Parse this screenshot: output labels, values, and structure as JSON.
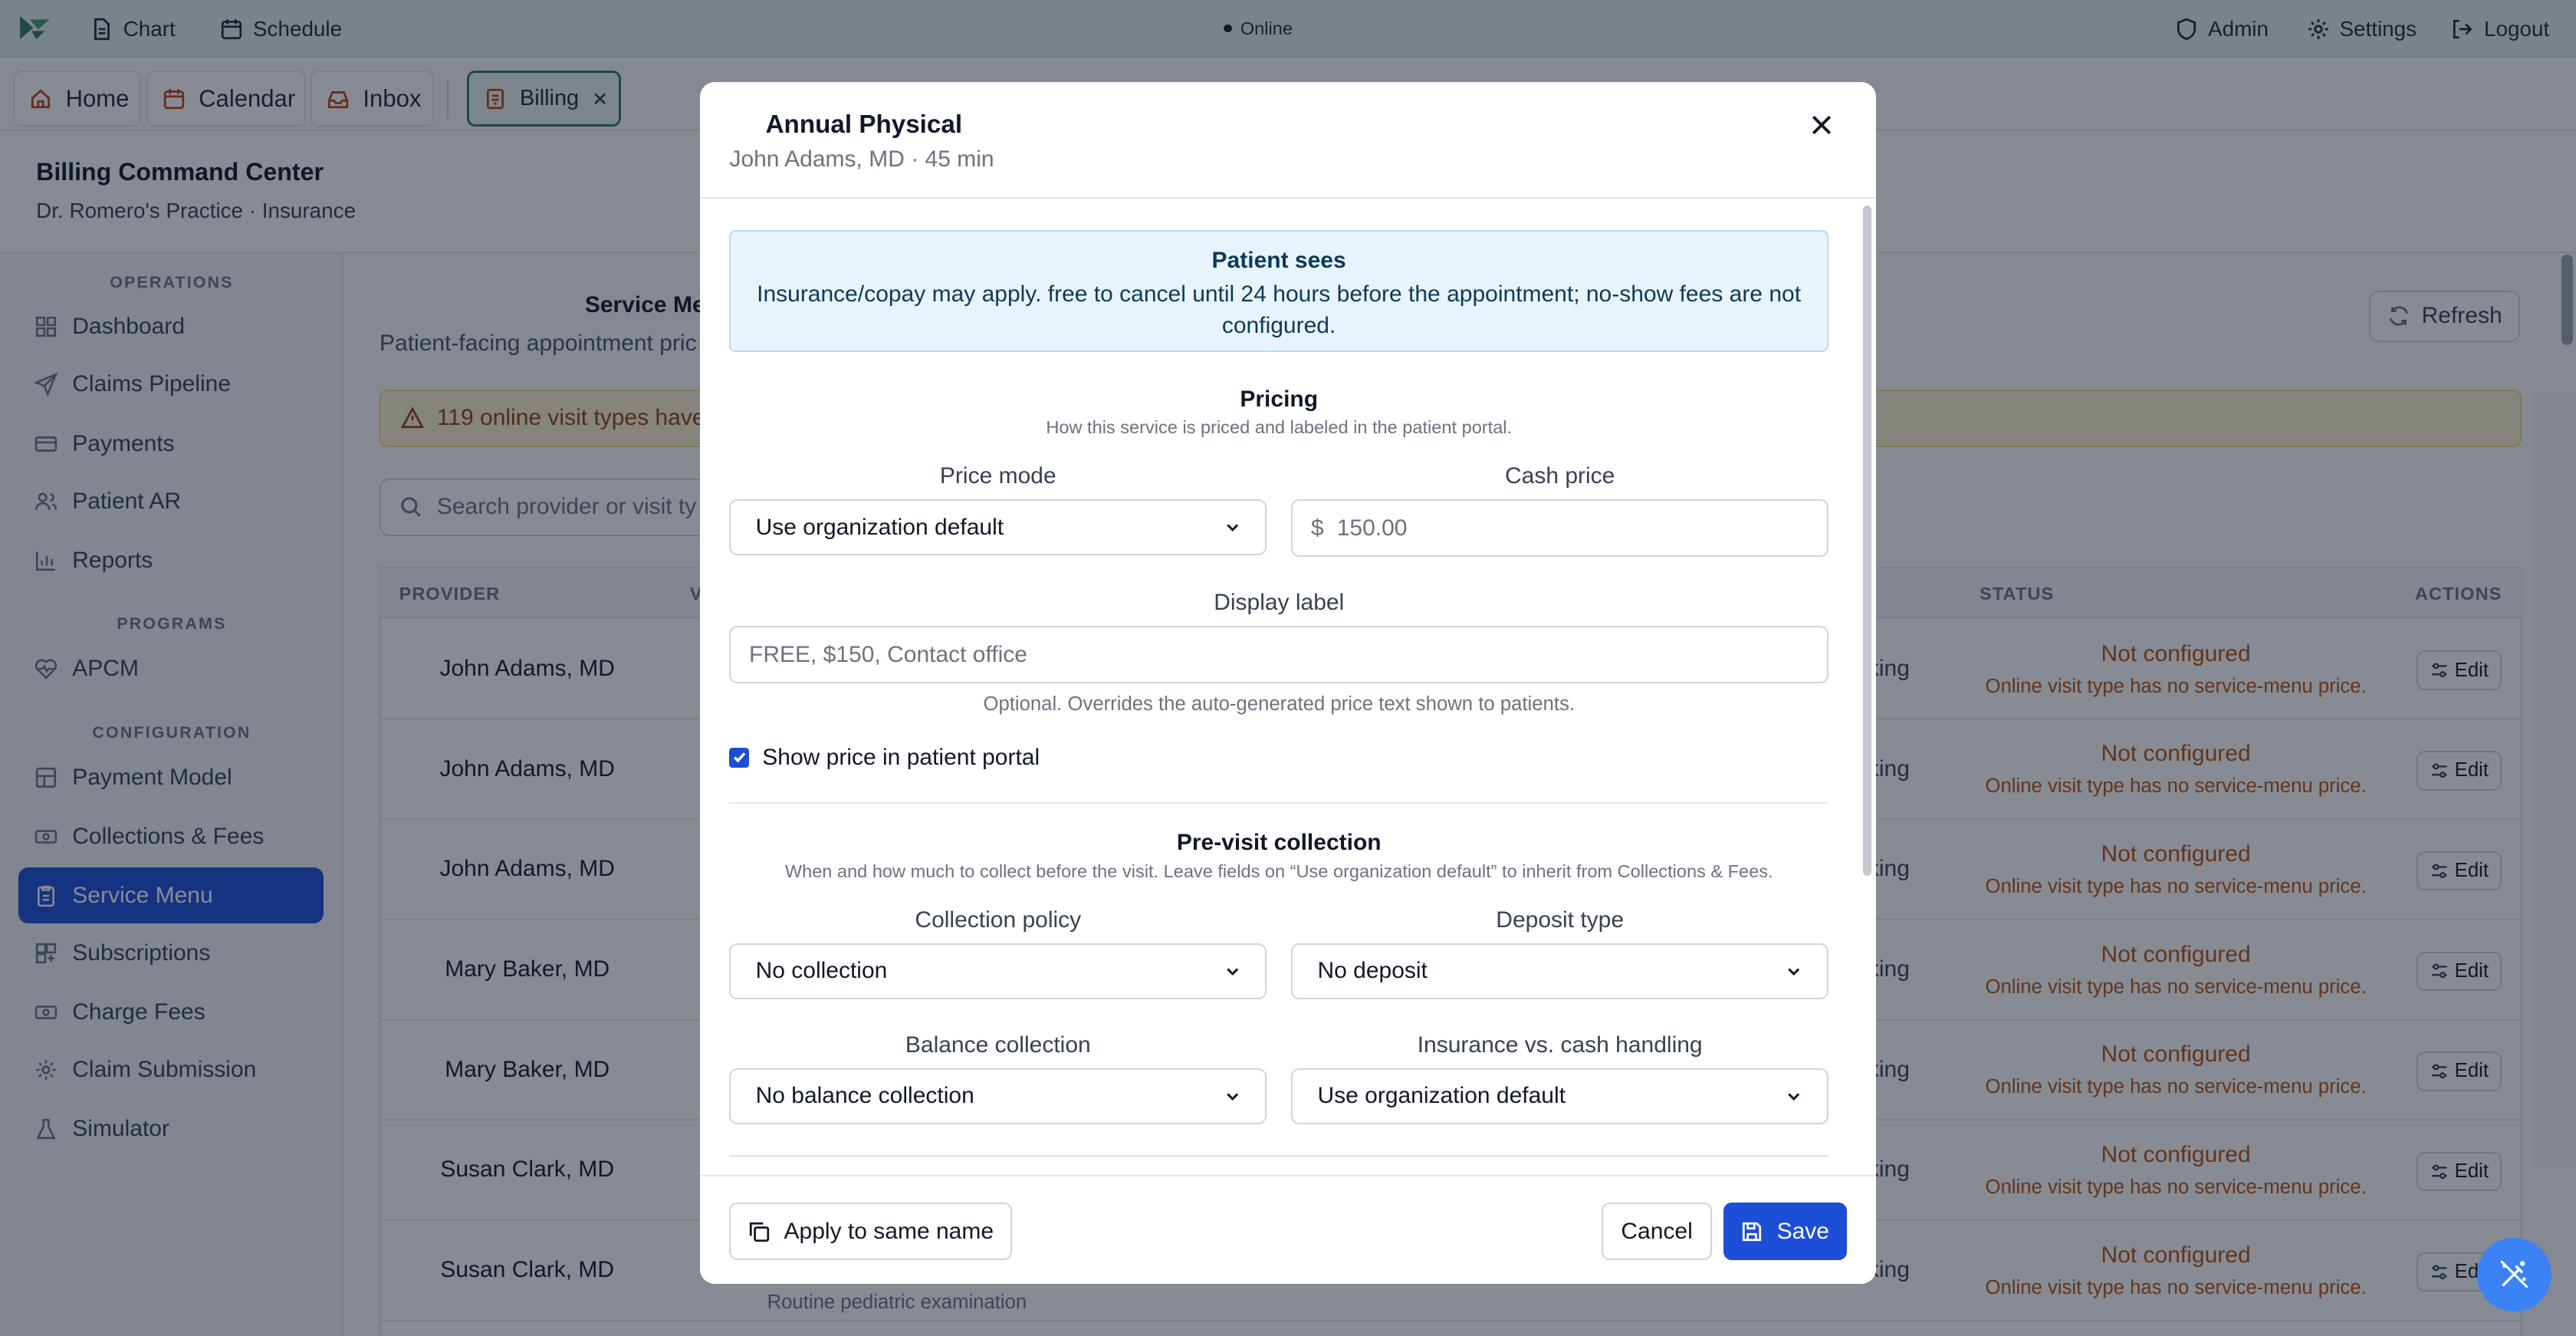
{
  "topbar": {
    "chart": "Chart",
    "schedule": "Schedule",
    "status": "Online",
    "admin": "Admin",
    "settings": "Settings",
    "logout": "Logout"
  },
  "tabs": [
    {
      "label": "Home"
    },
    {
      "label": "Calendar"
    },
    {
      "label": "Inbox"
    },
    {
      "label": "Billing"
    }
  ],
  "page": {
    "title": "Billing Command Center",
    "subtitle": "Dr. Romero's Practice · Insurance"
  },
  "sidebar": {
    "groups": [
      "OPERATIONS",
      "PROGRAMS",
      "CONFIGURATION"
    ],
    "items": [
      {
        "label": "Dashboard"
      },
      {
        "label": "Claims Pipeline"
      },
      {
        "label": "Payments"
      },
      {
        "label": "Patient AR"
      },
      {
        "label": "Reports"
      },
      {
        "label": "APCM"
      },
      {
        "label": "Payment Model"
      },
      {
        "label": "Collections & Fees"
      },
      {
        "label": "Service Menu"
      },
      {
        "label": "Subscriptions"
      },
      {
        "label": "Charge Fees"
      },
      {
        "label": "Claim Submission"
      },
      {
        "label": "Simulator"
      }
    ]
  },
  "main": {
    "title": "Service Me",
    "subtitle": "Patient-facing appointment pric",
    "refresh": "Refresh",
    "warning": "119 online visit types have",
    "search_placeholder": "Search provider or visit ty",
    "columns": {
      "provider": "PROVIDER",
      "v": "V",
      "status": "STATUS",
      "actions": "ACTIONS"
    },
    "rows": [
      {
        "provider": "John Adams, MD",
        "booking": "oking",
        "status": "Not configured",
        "detail": "Online visit type has no service-menu price.",
        "action": "Edit"
      },
      {
        "provider": "John Adams, MD",
        "booking": "oking",
        "status": "Not configured",
        "detail": "Online visit type has no service-menu price.",
        "action": "Edit"
      },
      {
        "provider": "John Adams, MD",
        "booking": "oking",
        "status": "Not configured",
        "detail": "Online visit type has no service-menu price.",
        "action": "Edit"
      },
      {
        "provider": "Mary Baker, MD",
        "booking": "oking",
        "status": "Not configured",
        "detail": "Online visit type has no service-menu price.",
        "action": "Edit"
      },
      {
        "provider": "Mary Baker, MD",
        "booking": "oking",
        "status": "Not configured",
        "detail": "Online visit type has no service-menu price.",
        "action": "Edit"
      },
      {
        "provider": "Susan Clark, MD",
        "booking": "oking",
        "status": "Not configured",
        "detail": "Online visit type has no service-menu price.",
        "action": "Edit"
      },
      {
        "provider": "Susan Clark, MD",
        "booking": "oking",
        "status": "Not configured",
        "detail": "Online visit type has no service-menu price.",
        "action": "Edit"
      }
    ],
    "partial_row_text": "Routine pediatric examination"
  },
  "modal": {
    "title": "Annual Physical",
    "subtitle": "John Adams, MD · 45 min",
    "patient_sees": {
      "heading": "Patient sees",
      "text": "Insurance/copay may apply. free to cancel until 24 hours before the appointment; no-show fees are not configured."
    },
    "pricing": {
      "heading": "Pricing",
      "description": "How this service is priced and labeled in the patient portal.",
      "price_mode_label": "Price mode",
      "price_mode_value": "Use organization default",
      "cash_price_label": "Cash price",
      "currency_symbol": "$",
      "cash_price_placeholder": "150.00",
      "display_label_label": "Display label",
      "display_label_placeholder": "FREE, $150, Contact office",
      "display_label_hint": "Optional. Overrides the auto-generated price text shown to patients.",
      "show_price_label": "Show price in patient portal",
      "show_price_checked": true
    },
    "previsit": {
      "heading": "Pre-visit collection",
      "description": "When and how much to collect before the visit. Leave fields on “Use organization default” to inherit from Collections & Fees.",
      "collection_policy_label": "Collection policy",
      "collection_policy_value": "No collection",
      "deposit_type_label": "Deposit type",
      "deposit_type_value": "No deposit",
      "balance_collection_label": "Balance collection",
      "balance_collection_value": "No balance collection",
      "insurance_cash_label": "Insurance vs. cash handling",
      "insurance_cash_value": "Use organization default"
    },
    "footer": {
      "apply_same_name": "Apply to same name",
      "cancel": "Cancel",
      "save": "Save"
    }
  },
  "colors": {
    "primary": "#1d4ed8",
    "topbar_bg": "#e3f1ea",
    "warning_text": "#b45309",
    "info_bg": "#e8f4fb"
  }
}
